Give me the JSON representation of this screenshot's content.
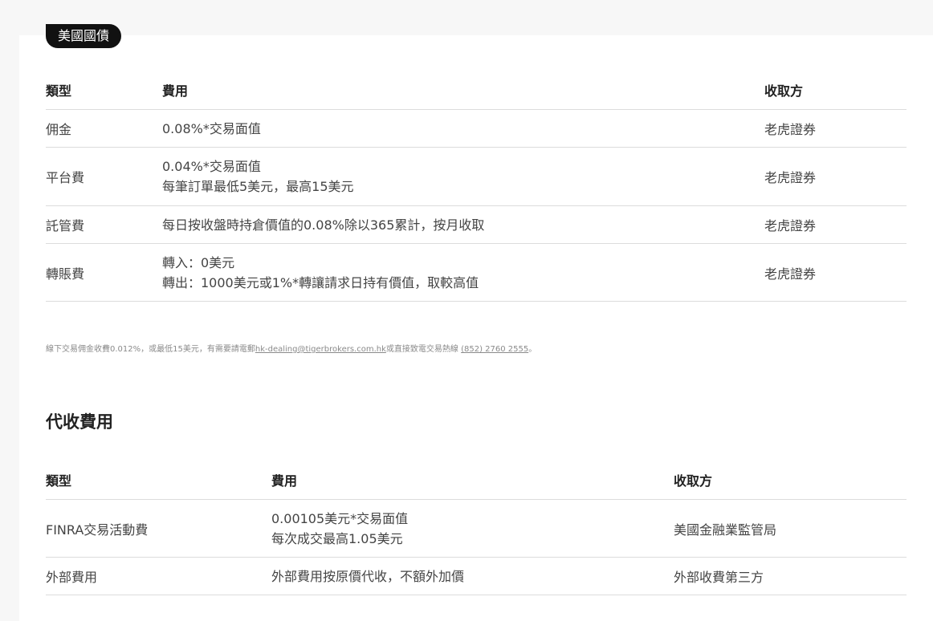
{
  "badge": "美國國債",
  "table1": {
    "headers": {
      "type": "類型",
      "fee": "費用",
      "collector": "收取方"
    },
    "rows": [
      {
        "type": "佣金",
        "fee_line1": "0.08%*交易面值",
        "fee_line2": "",
        "collector": "老虎證券"
      },
      {
        "type": "平台費",
        "fee_line1": "0.04%*交易面值",
        "fee_line2": "每筆訂單最低5美元，最高15美元",
        "collector": "老虎證券"
      },
      {
        "type": "託管費",
        "fee_line1": "每日按收盤時持倉價值的0.08%除以365累計，按月收取",
        "fee_line2": "",
        "collector": "老虎證券"
      },
      {
        "type": "轉賬費",
        "fee_line1": "轉入：0美元",
        "fee_line2": "轉出：1000美元或1%*轉讓請求日持有價值，取較高值",
        "collector": "老虎證券"
      }
    ]
  },
  "note": {
    "prefix": "線下交易佣金收費0.012%，或最低15美元，有需要請電郵",
    "email": "hk-dealing@tigerbrokers.com.hk",
    "middle": "或直接致電交易熱線 ",
    "phone": "(852) 2760 2555",
    "suffix": "。"
  },
  "section_title": "代收費用",
  "table2": {
    "headers": {
      "type": "類型",
      "fee": "費用",
      "collector": "收取方"
    },
    "rows": [
      {
        "type": "FINRA交易活動費",
        "fee_line1": "0.00105美元*交易面值",
        "fee_line2": "每次成交最高1.05美元",
        "collector": "美國金融業監管局"
      },
      {
        "type": "外部費用",
        "fee_line1": "外部費用按原價代收，不額外加價",
        "fee_line2": "",
        "collector": "外部收費第三方"
      }
    ]
  }
}
